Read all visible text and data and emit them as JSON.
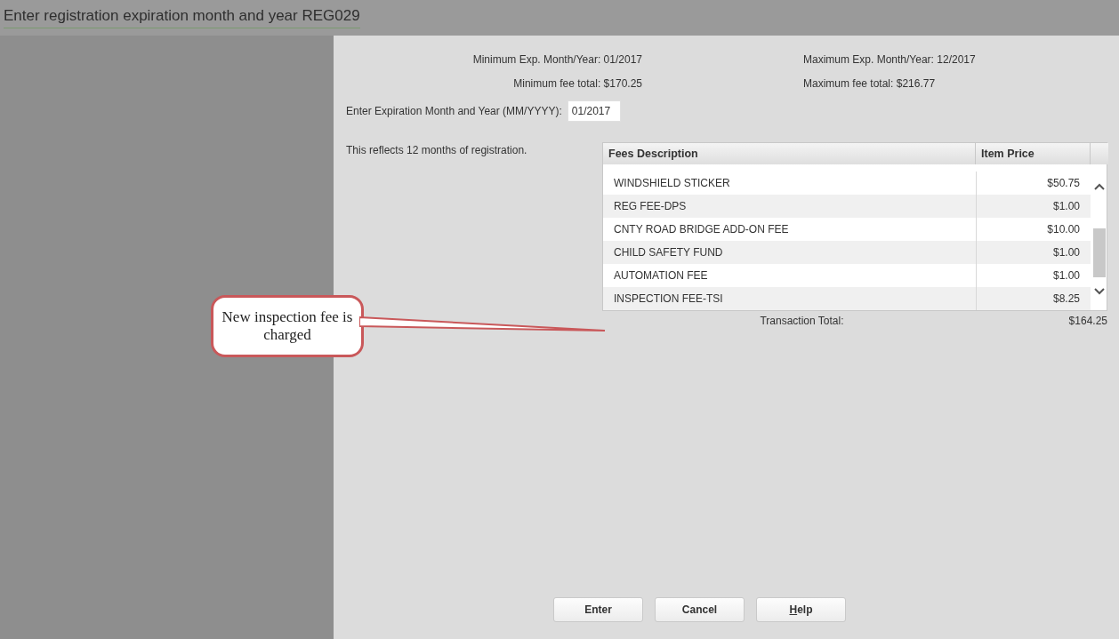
{
  "window": {
    "title": "Enter registration expiration month and year REG029"
  },
  "limits": [
    {
      "minimum": "Minimum Exp. Month/Year: 01/2017",
      "maximum": "Maximum Exp. Month/Year: 12/2017"
    },
    {
      "minimum": "Minimum fee total: $170.25",
      "maximum": "Maximum fee total: $216.77"
    }
  ],
  "expiration_field": {
    "label": "Enter Expiration Month and Year (MM/YYYY):",
    "value": "01/2017"
  },
  "note": "This reflects 12 months of registration.",
  "fees_table": {
    "columns": [
      "Fees Description",
      "Item Price"
    ],
    "rows": [
      {
        "description": "WINDSHIELD STICKER",
        "price": "$50.75"
      },
      {
        "description": "REG FEE-DPS",
        "price": "$1.00"
      },
      {
        "description": "CNTY ROAD BRIDGE ADD-ON FEE",
        "price": "$10.00"
      },
      {
        "description": "CHILD SAFETY FUND",
        "price": "$1.00"
      },
      {
        "description": "AUTOMATION FEE",
        "price": "$1.00"
      },
      {
        "description": "INSPECTION FEE-TSI",
        "price": "$8.25"
      }
    ],
    "total_label": "Transaction Total:",
    "total": "$164.25"
  },
  "callout": {
    "text": "New inspection fee is charged"
  },
  "buttons": [
    {
      "label": "Enter",
      "mnemonic": false
    },
    {
      "label": "Cancel",
      "mnemonic": false
    },
    {
      "label": "Help",
      "mnemonic": true
    }
  ]
}
